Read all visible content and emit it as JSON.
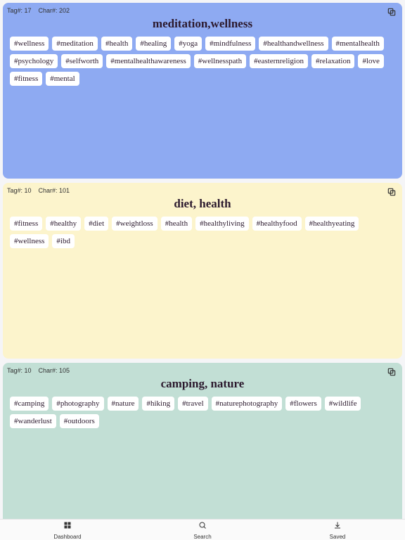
{
  "metaLabels": {
    "tag": "Tag#:",
    "char": "Char#:"
  },
  "cards": [
    {
      "tagCount": "17",
      "charCount": "202",
      "title": "meditation,wellness",
      "colorClass": "card-blue",
      "tags": [
        "#wellness",
        "#meditation",
        "#health",
        "#healing",
        "#yoga",
        "#mindfulness",
        "#healthandwellness",
        "#mentalhealth",
        "#psychology",
        "#selfworth",
        "#mentalhealthawareness",
        "#wellnesspath",
        "#easternreligion",
        "#relaxation",
        "#love",
        "#fitness",
        "#mental"
      ]
    },
    {
      "tagCount": "10",
      "charCount": "101",
      "title": "diet, health",
      "colorClass": "card-yellow",
      "tags": [
        "#fitness",
        "#healthy",
        "#diet",
        "#weightloss",
        "#health",
        "#healthyliving",
        "#healthyfood",
        "#healthyeating",
        "#wellness",
        "#ibd"
      ]
    },
    {
      "tagCount": "10",
      "charCount": "105",
      "title": "camping, nature",
      "colorClass": "card-teal",
      "tags": [
        "#camping",
        "#photography",
        "#nature",
        "#hiking",
        "#travel",
        "#naturephotography",
        "#flowers",
        "#wildlife",
        "#wanderlust",
        "#outdoors"
      ]
    }
  ],
  "nav": {
    "dashboard": "Dashboard",
    "search": "Search",
    "saved": "Saved"
  }
}
